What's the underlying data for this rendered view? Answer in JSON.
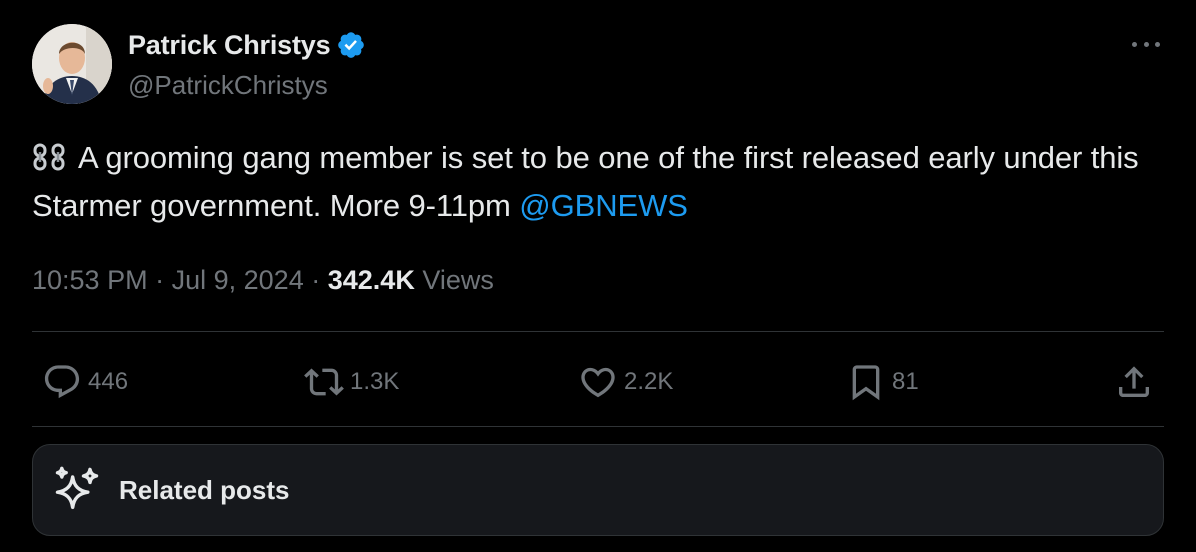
{
  "author": {
    "display_name": "Patrick Christys",
    "handle": "@PatrickChristys",
    "verified": true,
    "avatar_icon": "profile-photo"
  },
  "post": {
    "text_main": "A grooming gang member is set to be one of the first released early under this Starmer government. More 9-11pm ",
    "leading_emoji": "chains-emoji",
    "mention": "@GBNEWS"
  },
  "meta": {
    "time": "10:53 PM",
    "separator": "·",
    "date": "Jul 9, 2024",
    "views_count": "342.4K",
    "views_label": "Views"
  },
  "actions": {
    "replies": "446",
    "reposts": "1.3K",
    "likes": "2.2K",
    "bookmarks": "81"
  },
  "related": {
    "label": "Related posts"
  },
  "colors": {
    "background": "#000000",
    "text": "#e7e9ea",
    "muted": "#71767b",
    "accent": "#1d9bf0",
    "divider": "#2f3336"
  }
}
